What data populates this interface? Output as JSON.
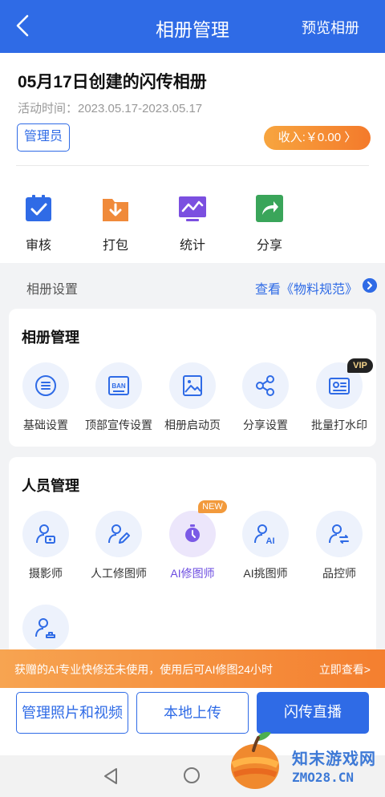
{
  "header": {
    "title": "相册管理",
    "preview": "预览相册"
  },
  "album": {
    "title": "05月17日创建的闪传相册",
    "activity": "活动时间：2023.05.17-2023.05.17",
    "role": "管理员",
    "income": "收入:￥0.00 〉"
  },
  "quick_actions": [
    "审核",
    "打包",
    "统计",
    "分享"
  ],
  "settings": {
    "label": "相册设置",
    "link": "查看《物料规范》"
  },
  "album_mgmt": {
    "title": "相册管理",
    "items": [
      "基础设置",
      "顶部宣传设置",
      "相册启动页",
      "分享设置",
      "批量打水印"
    ],
    "vip": "VIP"
  },
  "staff_mgmt": {
    "title": "人员管理",
    "items": [
      "摄影师",
      "人工修图师",
      "AI修图师",
      "AI挑图师",
      "品控师"
    ],
    "new_tag": "NEW"
  },
  "banner": {
    "message": "获赠的AI专业快修还未使用，使用后可AI修图24小时",
    "cta": "立即查看>"
  },
  "actions": {
    "manage": "管理照片和视频",
    "upload": "本地上传",
    "live": "闪传直播"
  },
  "watermark": {
    "name": "知末游戏网",
    "domain": "ZMO28.CN"
  },
  "colors": {
    "primary": "#2f6be6",
    "accent": "#f47a2b",
    "ai": "#6b4be0"
  }
}
